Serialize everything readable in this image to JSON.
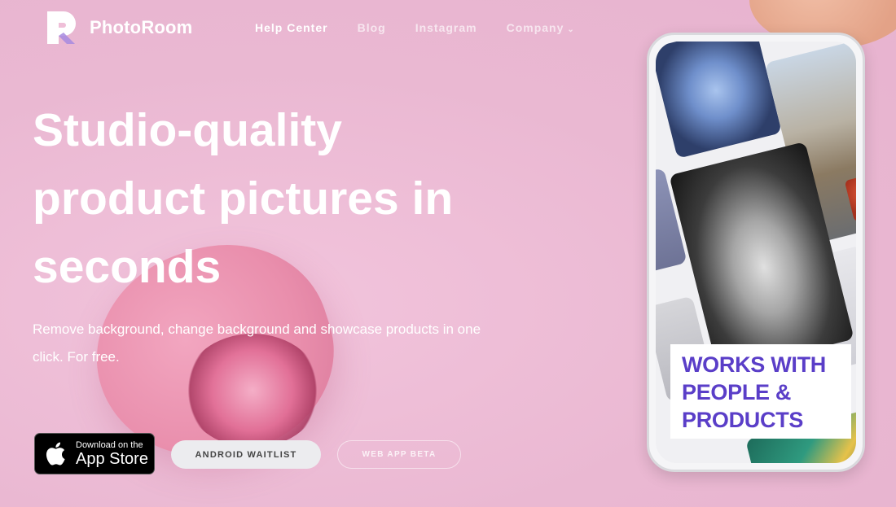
{
  "brand": {
    "name": "PhotoRoom"
  },
  "nav": {
    "items": [
      {
        "label": "Help Center"
      },
      {
        "label": "Blog"
      },
      {
        "label": "Instagram"
      },
      {
        "label": "Company"
      }
    ]
  },
  "hero": {
    "title": "Studio-quality product pictures in seconds",
    "subtitle": "Remove background, change background and showcase products in one click. For free."
  },
  "buttons": {
    "appstore_small": "Download on the",
    "appstore_big": "App Store",
    "android": "ANDROID WAITLIST",
    "web": "WEB APP BETA"
  },
  "phone": {
    "callout_lines": [
      "WORKS WITH",
      "PEOPLE &",
      "PRODUCTS"
    ]
  },
  "colors": {
    "background": "#efbfd8",
    "callout_text": "#5a3ec8"
  }
}
